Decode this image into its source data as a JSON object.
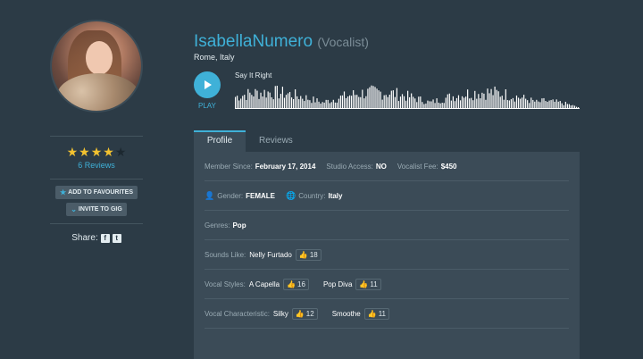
{
  "profile": {
    "name": "IsabellaNumero",
    "role": "(Vocalist)",
    "location": "Rome, Italy",
    "rating": 4,
    "rating_max": 5,
    "reviews_link": "6 Reviews"
  },
  "actions": {
    "add_favourites": "ADD TO FAVOURITES",
    "invite_gig": "INVITE TO GIG",
    "share_label": "Share:"
  },
  "player": {
    "play_label": "PLAY",
    "track_title": "Say It Right"
  },
  "tabs": [
    {
      "label": "Profile",
      "active": true
    },
    {
      "label": "Reviews",
      "active": false
    }
  ],
  "details": {
    "member_since_label": "Member Since:",
    "member_since": "February 17, 2014",
    "studio_access_label": "Studio Access:",
    "studio_access": "NO",
    "vocalist_fee_label": "Vocalist Fee:",
    "vocalist_fee": "$450",
    "gender_label": "Gender:",
    "gender": "FEMALE",
    "country_label": "Country:",
    "country": "Italy",
    "genres_label": "Genres:",
    "genres": "Pop",
    "sounds_like_label": "Sounds Like:",
    "sounds_like": [
      {
        "name": "Nelly Furtado",
        "likes": "18",
        "highlighted": true
      }
    ],
    "vocal_styles_label": "Vocal Styles:",
    "vocal_styles": [
      {
        "name": "A Capella",
        "likes": "16",
        "highlighted": true
      },
      {
        "name": "Pop Diva",
        "likes": "11",
        "highlighted": true
      }
    ],
    "vocal_char_label": "Vocal Characteristic:",
    "vocal_characteristics": [
      {
        "name": "Silky",
        "likes": "12",
        "highlighted": false
      },
      {
        "name": "Smoothe",
        "likes": "11",
        "highlighted": false
      }
    ]
  },
  "colors": {
    "accent": "#3fb1d8",
    "background": "#2c3b46",
    "panel": "#3b4b57",
    "star": "#f2c230",
    "like_green": "#4ec25a"
  }
}
